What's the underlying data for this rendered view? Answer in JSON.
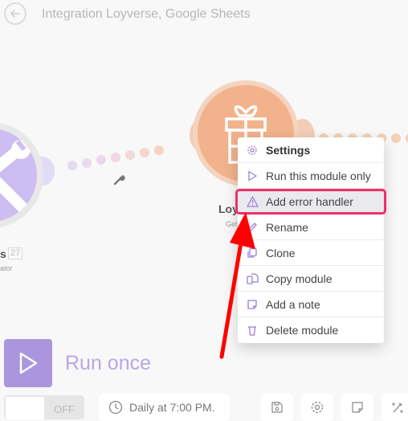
{
  "header": {
    "back_icon": "arrow-left-circle-icon",
    "title": "Integration Loyverse, Google Sheets"
  },
  "modules": {
    "tools": {
      "icon": "wrench-screwdriver-icon",
      "label": "s",
      "count": "27",
      "subtitle": "ator",
      "color": "#cdbdf2"
    },
    "link": {
      "icon": "wrench-icon"
    },
    "loyverse": {
      "icon": "gift-icon",
      "label": "Loy",
      "subtitle": "Get",
      "color": "#f2b28c"
    }
  },
  "context_menu": {
    "items": [
      {
        "label": "Settings",
        "icon": "gear-icon"
      },
      {
        "label": "Run this module only",
        "icon": "play-icon"
      },
      {
        "label": "Add error handler",
        "icon": "warning-icon",
        "highlighted": true
      },
      {
        "label": "Rename",
        "icon": "pencil-icon"
      },
      {
        "label": "Clone",
        "icon": "clone-icon"
      },
      {
        "label": "Copy module",
        "icon": "copy-icon"
      },
      {
        "label": "Add a note",
        "icon": "note-icon"
      },
      {
        "label": "Delete module",
        "icon": "trash-icon"
      }
    ]
  },
  "bottom_bar": {
    "run_once_label": "Run once",
    "toggle_state": "OFF",
    "schedule": "Daily at 7:00 PM.",
    "tools": [
      "save-icon",
      "gear-icon",
      "note-icon",
      "magic-wand-icon"
    ]
  },
  "colors": {
    "accent_purple": "#9b7fd8",
    "highlight_border": "#f0306a",
    "annotation_arrow": "#ff0000"
  }
}
